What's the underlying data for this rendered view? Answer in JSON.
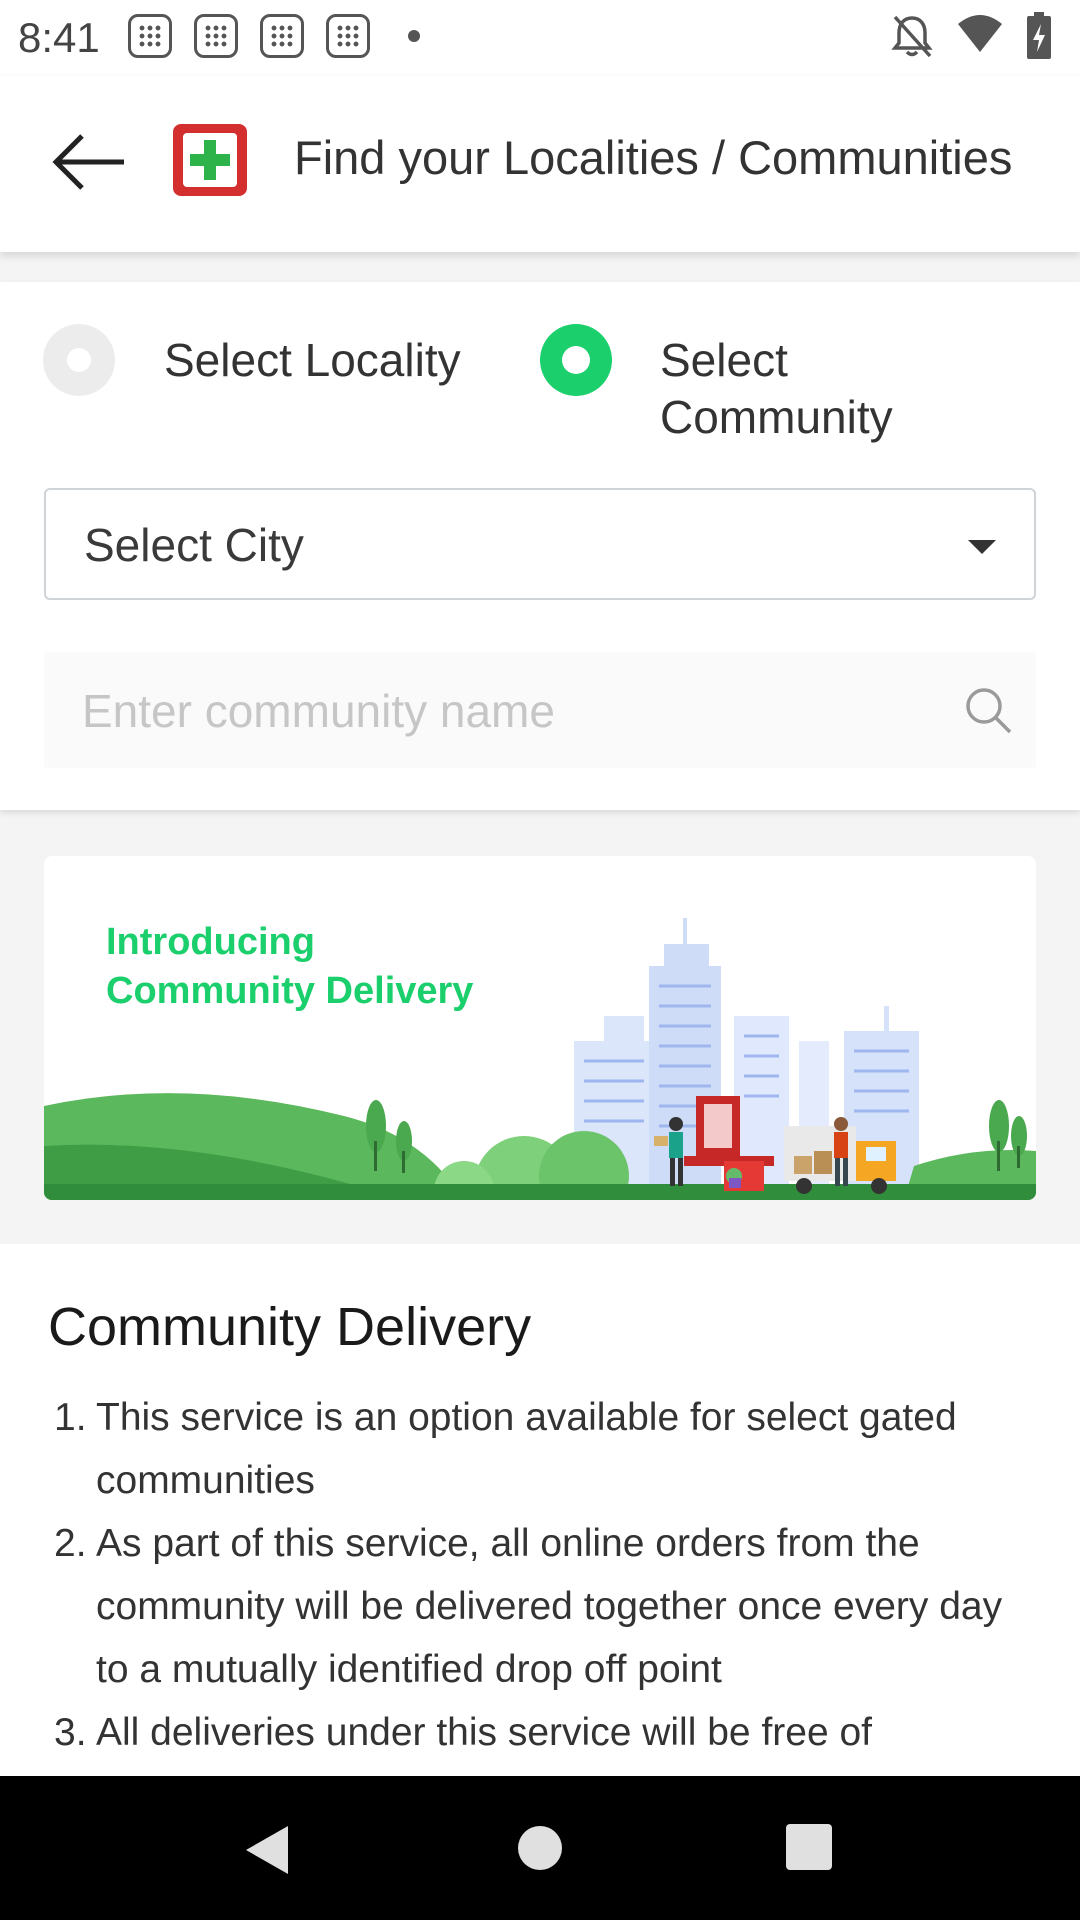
{
  "status_bar": {
    "time": "8:41",
    "notification_icons": [
      "dialpad-icon",
      "dialpad-icon",
      "dialpad-icon",
      "dialpad-icon"
    ],
    "right_icons": [
      "bell-off-icon",
      "wifi-icon",
      "battery-charging-icon"
    ]
  },
  "app_bar": {
    "title": "Find your Localities / Communities",
    "back_icon": "arrow-left-icon",
    "logo_icon": "plus-cross-icon"
  },
  "filter": {
    "options": [
      {
        "label": "Select Locality",
        "selected": false
      },
      {
        "label": "Select Community",
        "selected": true
      }
    ],
    "city_select": {
      "label": "Select City"
    },
    "search": {
      "placeholder": "Enter community name",
      "value": ""
    }
  },
  "banner": {
    "line1": "Introducing",
    "line2": "Community Delivery"
  },
  "content": {
    "title": "Community Delivery",
    "items": [
      {
        "num": "1.",
        "text": "This service is an option available for select gated communities"
      },
      {
        "num": "2.",
        "text": "As part of this service, all online orders from the community will be delivered together once every day to a mutually identified drop off point"
      },
      {
        "num": "3.",
        "text": "All deliveries under this service will be free of"
      }
    ]
  },
  "colors": {
    "accent": "#1bcf6c",
    "brand_red": "#d32f2f",
    "nav_bar": "#000000"
  }
}
